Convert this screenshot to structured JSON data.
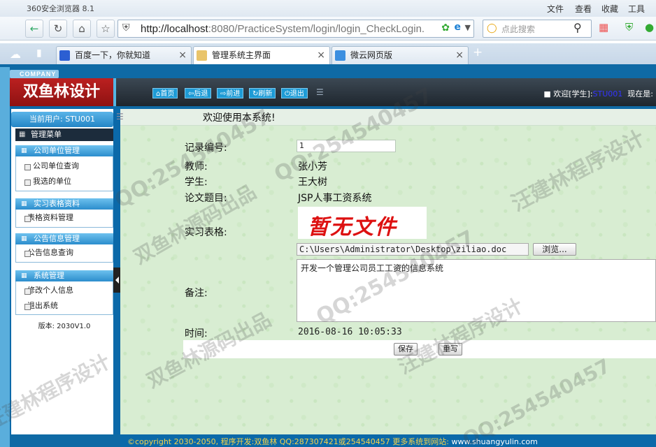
{
  "browser": {
    "window_title": "360安全浏览器 8.1",
    "menu": [
      "文件",
      "查看",
      "收藏",
      "工具"
    ],
    "address_host": "http://localhost",
    "address_rest": ":8080/PracticeSystem/login/login_CheckLogin.",
    "search_placeholder": "点此搜索",
    "tabs": [
      {
        "label": "百度一下，你就知道",
        "icon": "baidu-icon",
        "active": false
      },
      {
        "label": "管理系统主界面",
        "icon": "page-icon",
        "active": true
      },
      {
        "label": "微云网页版",
        "icon": "cloud-icon",
        "active": false
      }
    ],
    "new_tab": "+"
  },
  "app": {
    "company_tag": "COMPANY",
    "brand": "双鱼林设计",
    "nav": [
      {
        "label": "首页",
        "icon": "home-icon"
      },
      {
        "label": "后退",
        "icon": "back-icon"
      },
      {
        "label": "前进",
        "icon": "forward-icon"
      },
      {
        "label": "刷新",
        "icon": "refresh-icon"
      },
      {
        "label": "退出",
        "icon": "power-icon"
      }
    ],
    "welcome_prefix": "欢迎[学生]:",
    "welcome_user": "STU001",
    "now_label": "现在是:"
  },
  "sidebar": {
    "current_user": "当前用户: STU001",
    "menu_title": "管理菜单",
    "sections": [
      {
        "title": "公司单位管理",
        "items": [
          "公司单位查询",
          "我选的单位"
        ]
      },
      {
        "title": "实习表格资料",
        "items": [
          "表格资料管理"
        ]
      },
      {
        "title": "公告信息管理",
        "items": [
          "公告信息查询"
        ]
      },
      {
        "title": "系统管理",
        "items": [
          "修改个人信息",
          "退出系统"
        ]
      }
    ],
    "version": "版本: 2030V1.0"
  },
  "main": {
    "title": "欢迎使用本系统!",
    "form": {
      "record_label": "记录编号:",
      "record_value": "1",
      "teacher_label": "教师:",
      "teacher_value": "张小芳",
      "student_label": "学生:",
      "student_value": "王大树",
      "thesis_label": "论文题目:",
      "thesis_value": "JSP人事工资系统",
      "table_label": "实习表格:",
      "no_file_text": "暂无文件",
      "file_path": "C:\\Users\\Administrator\\Desktop\\ziliao.doc",
      "browse_label": "浏览...",
      "notes_label": "备注:",
      "notes_value": "开发一个管理公司员工工资的信息系统",
      "time_label": "时间:",
      "time_value": "2016-08-16 10:05:33",
      "save_label": "保存",
      "reset_label": "重写"
    }
  },
  "footer": {
    "copyright": "©copyright 2030-2050, 程序开发:双鱼林  QQ:287307421或254540457  更多系统到网站:",
    "site": "www.shuangyulin.com"
  },
  "watermarks": [
    "QQ:254540457",
    "双鱼林源码出品",
    "汪建林程序设计",
    "双鱼林源码出品",
    "汪建林程序设计"
  ]
}
